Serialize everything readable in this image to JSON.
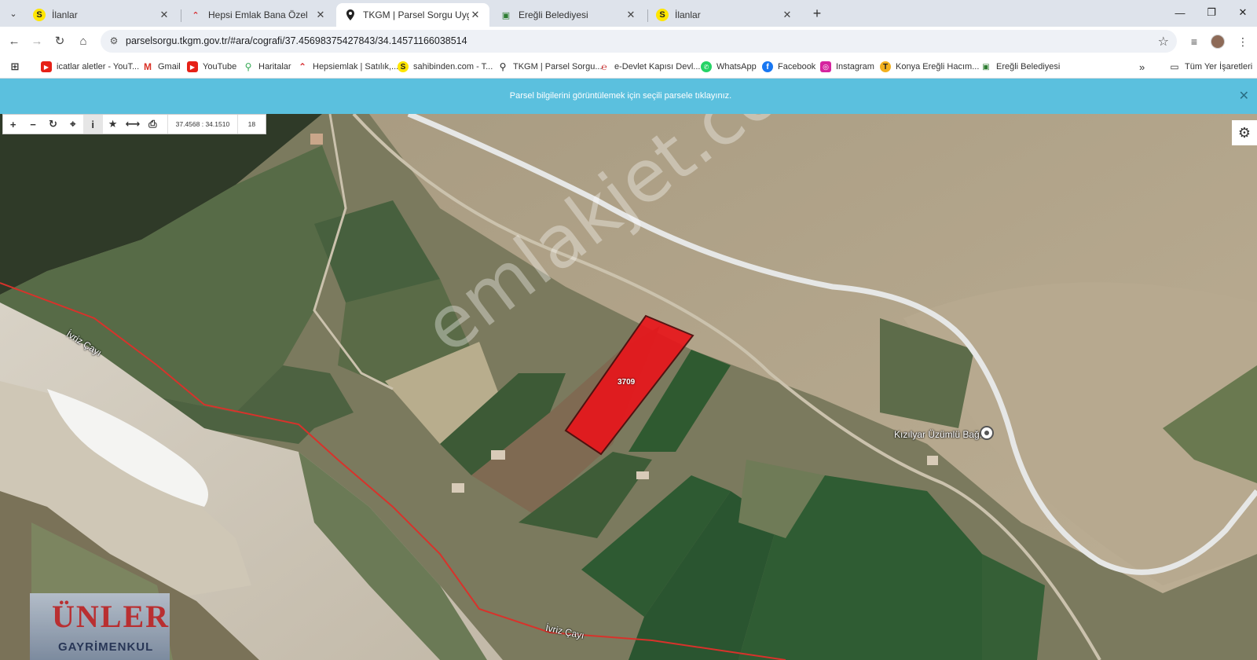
{
  "browser": {
    "tabs": [
      {
        "title": "İlanlar",
        "icon": "sahibinden-icon",
        "active": false
      },
      {
        "title": "Hepsi Emlak Bana Özel",
        "icon": "hepsiemlak-icon",
        "active": false
      },
      {
        "title": "TKGM | Parsel Sorgu Uygulama",
        "icon": "location-pin-icon",
        "active": true
      },
      {
        "title": "Ereğli Belediyesi",
        "icon": "municipality-icon",
        "active": false
      },
      {
        "title": "İlanlar",
        "icon": "sahibinden-icon",
        "active": false
      }
    ],
    "url": "parselsorgu.tkgm.gov.tr/#ara/cografi/37.45698375427843/34.14571166038514",
    "bookmarks": [
      {
        "label": "icatlar aletler - YouT...",
        "icon": "youtube-icon"
      },
      {
        "label": "Gmail",
        "icon": "gmail-icon"
      },
      {
        "label": "YouTube",
        "icon": "youtube-icon"
      },
      {
        "label": "Haritalar",
        "icon": "maps-icon"
      },
      {
        "label": "Hepsiemlak | Satılık,...",
        "icon": "hepsiemlak-icon"
      },
      {
        "label": "sahibinden.com - T...",
        "icon": "sahibinden-icon"
      },
      {
        "label": "TKGM | Parsel Sorgu...",
        "icon": "location-pin-icon"
      },
      {
        "label": "e-Devlet Kapısı Devl...",
        "icon": "edevlet-icon"
      },
      {
        "label": "WhatsApp",
        "icon": "whatsapp-icon"
      },
      {
        "label": "Facebook",
        "icon": "facebook-icon"
      },
      {
        "label": "Instagram",
        "icon": "instagram-icon"
      },
      {
        "label": "Konya Ereğli Hacım...",
        "icon": "site-icon"
      },
      {
        "label": "Ereğli Belediyesi",
        "icon": "municipality-icon"
      }
    ],
    "all_bookmarks_label": "Tüm Yer İşaretleri"
  },
  "notice": {
    "text": "Parsel bilgilerini görüntülemek için seçili parsele tıklayınız."
  },
  "map": {
    "coordinates": "37.4568 : 34.1510",
    "zoom": "18",
    "parcel_number": "3709",
    "place_label": "Kızılyar Üzümlü Bağı",
    "river_label": "İvriz Çayı",
    "watermark": "emlakjet.com",
    "logo_main": "ÜNLER",
    "logo_sub": "GAYRİMENKUL",
    "colors": {
      "parcel": "#e8161b",
      "notice": "#5bc0de",
      "boundary": "#d8322b"
    }
  }
}
